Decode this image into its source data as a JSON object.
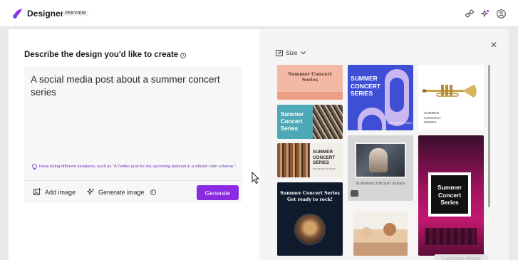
{
  "header": {
    "app_title": "Designer",
    "badge": "PREVIEW",
    "icons": [
      "designer-logo-icon",
      "share-icon",
      "premium-spark-icon",
      "user-profile-icon"
    ]
  },
  "left_panel": {
    "heading": "Describe the design you'd like to create",
    "prompt_text": "A social media post about a summer concert series",
    "tip": "Keep trying different variations, such as \"A Twitter post for my upcoming podcast in a vibrant color scheme.\"",
    "add_image_label": "Add image",
    "generate_image_label": "Generate image",
    "generate_button": "Generate"
  },
  "right_panel": {
    "size_label": "Size",
    "customize_button": "Customize design",
    "designs": [
      {
        "title": "Summer Concert Series",
        "style": "peach banner"
      },
      {
        "title": "SUMMER CONCERT SERIES",
        "subtitle": "GET READY TO ROCK!",
        "style": "purple blue"
      },
      {
        "title": "SUMMER CONCERT SERIES",
        "style": "trumpet"
      },
      {
        "title": "Summer Concert Series",
        "style": "teal guitar"
      },
      {
        "title": "SUMMER CONCERT SERIES",
        "subtitle": "GET READY TO ROCK!",
        "style": "guitars"
      },
      {
        "title": "SUMMER CONCERT SERIES",
        "style": "violinist"
      },
      {
        "title": "Summer Concert Series",
        "style": "stage lights"
      },
      {
        "title": "Summer Concert Series",
        "subtitle": "Get ready to rock!",
        "style": "navy band"
      },
      {
        "title": "",
        "style": "kids photo"
      }
    ]
  },
  "colors": {
    "accent": "#8a2be2",
    "tip_text": "#6b2fbf"
  }
}
